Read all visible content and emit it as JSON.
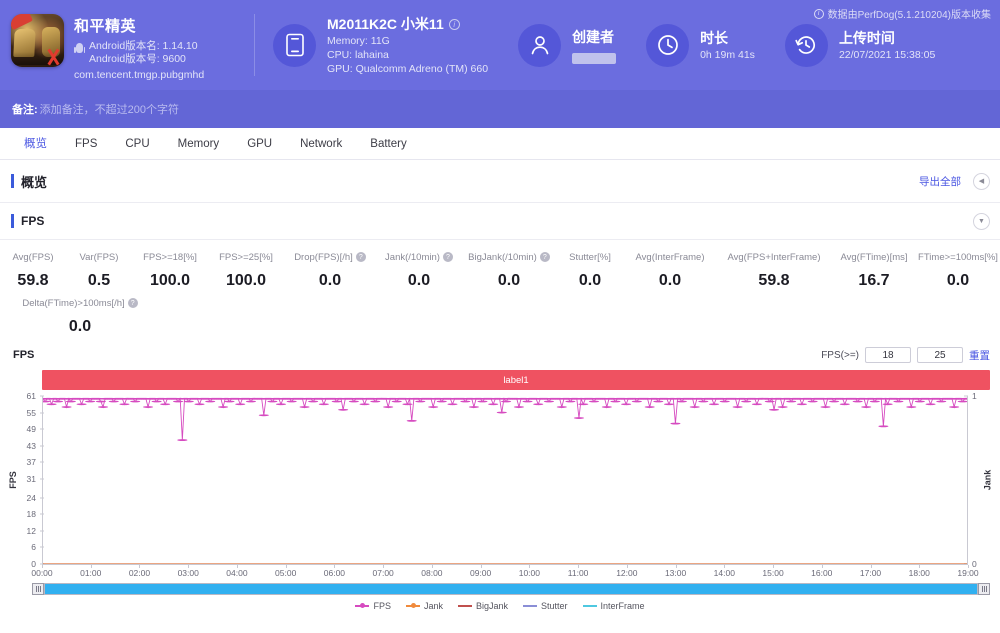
{
  "header": {
    "app": {
      "name": "和平精英",
      "version_name_label": "Android版本名: 1.14.10",
      "version_code_label": "Android版本号: 9600",
      "package": "com.tencent.tmgp.pubgmhd",
      "icon": "game-app-icon"
    },
    "device": {
      "title": "M2011K2C 小米11",
      "info_icon": "info-icon",
      "memory": "Memory: 11G",
      "cpu": "CPU: lahaina",
      "gpu": "GPU: Qualcomm Adreno (TM) 660",
      "icon": "phone-icon"
    },
    "creator": {
      "title": "创建者",
      "value": "",
      "icon": "user-icon"
    },
    "duration": {
      "title": "时长",
      "value": "0h 19m 41s",
      "icon": "clock-icon"
    },
    "upload_time": {
      "title": "上传时间",
      "value": "22/07/2021 15:38:05",
      "icon": "history-icon"
    },
    "perfdog_note": "数据由PerfDog(5.1.210204)版本收集",
    "remark_label": "备注:",
    "remark_placeholder": "添加备注，不超过200个字符"
  },
  "tabs": [
    {
      "label": "概览",
      "active": true
    },
    {
      "label": "FPS",
      "active": false
    },
    {
      "label": "CPU",
      "active": false
    },
    {
      "label": "Memory",
      "active": false
    },
    {
      "label": "GPU",
      "active": false
    },
    {
      "label": "Network",
      "active": false
    },
    {
      "label": "Battery",
      "active": false
    }
  ],
  "overview": {
    "title": "概览",
    "export_all": "导出全部",
    "collapse_icon": "chevron-left-icon"
  },
  "fps_section": {
    "title": "FPS",
    "collapse_icon": "chevron-down-icon",
    "metrics_row1": [
      {
        "label": "Avg(FPS)",
        "value": "59.8",
        "help": false
      },
      {
        "label": "Var(FPS)",
        "value": "0.5",
        "help": false
      },
      {
        "label": "FPS>=18[%]",
        "value": "100.0",
        "help": false
      },
      {
        "label": "FPS>=25[%]",
        "value": "100.0",
        "help": false
      },
      {
        "label": "Drop(FPS)[/h]",
        "value": "0.0",
        "help": true
      },
      {
        "label": "Jank(/10min)",
        "value": "0.0",
        "help": true
      },
      {
        "label": "BigJank(/10min)",
        "value": "0.0",
        "help": true
      },
      {
        "label": "Stutter[%]",
        "value": "0.0",
        "help": false
      },
      {
        "label": "Avg(InterFrame)",
        "value": "0.0",
        "help": false
      },
      {
        "label": "Avg(FPS+InterFrame)",
        "value": "59.8",
        "help": false
      },
      {
        "label": "Avg(FTime)[ms]",
        "value": "16.7",
        "help": false
      },
      {
        "label": "FTime>=100ms[%]",
        "value": "0.0",
        "help": false
      }
    ],
    "metrics_row2": [
      {
        "label": "Delta(FTime)>100ms[/h]",
        "value": "0.0",
        "help": true
      }
    ]
  },
  "chart_controls": {
    "chart_label": "FPS",
    "fps_gte_label": "FPS(>=)",
    "threshold_low": "18",
    "threshold_high": "25",
    "reset_label": "重置",
    "banner_label": "label1"
  },
  "chart_data": {
    "type": "line",
    "title": "FPS",
    "xlabel": "",
    "ylabel": "FPS",
    "y2label": "Jank",
    "ylim": [
      0,
      61
    ],
    "y2lim": [
      0,
      1
    ],
    "yticks": [
      0,
      6,
      12,
      18,
      24,
      31,
      37,
      43,
      49,
      55,
      61
    ],
    "y2ticks": [
      0,
      1
    ],
    "xticks": [
      "00:00",
      "01:00",
      "02:00",
      "03:00",
      "04:00",
      "05:00",
      "06:00",
      "07:00",
      "08:00",
      "09:00",
      "10:00",
      "11:00",
      "12:00",
      "13:00",
      "14:00",
      "15:00",
      "16:00",
      "17:00",
      "18:00",
      "19:00"
    ],
    "grid": false,
    "legend_position": "bottom",
    "series": [
      {
        "name": "FPS",
        "color": "#d64bc0",
        "axis": "left",
        "avg": 59.8,
        "min": 45,
        "max": 61,
        "note": "Dense near-flat trace at ~59-60 fps with sporadic downward spikes"
      },
      {
        "name": "Jank",
        "color": "#f08a3c",
        "axis": "right",
        "values_all_zero": true
      },
      {
        "name": "BigJank",
        "color": "#c0504d",
        "axis": "right",
        "values_all_zero": true
      },
      {
        "name": "Stutter",
        "color": "#8a8ed6",
        "axis": "right",
        "values_all_zero": true
      },
      {
        "name": "InterFrame",
        "color": "#4ec8e0",
        "axis": "right",
        "values_all_zero": true
      }
    ],
    "fps_points": [
      60,
      59,
      60,
      60,
      58,
      60,
      60,
      59,
      60,
      60,
      60,
      57,
      60,
      59,
      60,
      60,
      60,
      60,
      58,
      60,
      60,
      60,
      59,
      60,
      60,
      60,
      60,
      59,
      57,
      60,
      60,
      60,
      60,
      59,
      60,
      60,
      60,
      60,
      58,
      60,
      60,
      60,
      60,
      59,
      60,
      60,
      60,
      60,
      60,
      57,
      60,
      60,
      60,
      59,
      60,
      60,
      60,
      58,
      60,
      60,
      60,
      60,
      60,
      59,
      60,
      45,
      60,
      60,
      59,
      60,
      60,
      60,
      60,
      58,
      60,
      60,
      60,
      60,
      59,
      60,
      60,
      60,
      60,
      60,
      57,
      60,
      60,
      59,
      60,
      60,
      60,
      60,
      58,
      60,
      60,
      60,
      60,
      59,
      60,
      60,
      60,
      60,
      60,
      54,
      60,
      60,
      60,
      59,
      60,
      60,
      60,
      58,
      60,
      60,
      60,
      60,
      59,
      60,
      60,
      60,
      60,
      60,
      57,
      60,
      60,
      60,
      59,
      60,
      60,
      60,
      60,
      58,
      60,
      60,
      60,
      60,
      60,
      59,
      60,
      60,
      56,
      60,
      60,
      60,
      60,
      59,
      60,
      60,
      60,
      60,
      58,
      60,
      60,
      60,
      60,
      59,
      60,
      60,
      60,
      60,
      60,
      57,
      60,
      60,
      60,
      59,
      60,
      60,
      60,
      60,
      58,
      60,
      52,
      60,
      60,
      60,
      59,
      60,
      60,
      60,
      60,
      60,
      57,
      60,
      60,
      60,
      59,
      60,
      60,
      60,
      60,
      58,
      60,
      60,
      60,
      60,
      60,
      59,
      60,
      60,
      60,
      57,
      60,
      60,
      60,
      59,
      60,
      60,
      60,
      60,
      58,
      60,
      60,
      60,
      55,
      60,
      59,
      60,
      60,
      60,
      60,
      60,
      57,
      60,
      60,
      60,
      59,
      60,
      60,
      60,
      60,
      58,
      60,
      60,
      60,
      60,
      59,
      60,
      60,
      60,
      60,
      60,
      57,
      60,
      60,
      60,
      59,
      60,
      60,
      60,
      53,
      60,
      58,
      60,
      60,
      60,
      60,
      59,
      60,
      60,
      60,
      60,
      60,
      57,
      60,
      60,
      60,
      59,
      60,
      60,
      60,
      60,
      58,
      60,
      60,
      60,
      60,
      59,
      60,
      60,
      60,
      60,
      60,
      57,
      60,
      60,
      60,
      59,
      60,
      60,
      60,
      60,
      58,
      60,
      60,
      51,
      60,
      60,
      59,
      60,
      60,
      60,
      60,
      60,
      57,
      60,
      60,
      60,
      59,
      60,
      60,
      60,
      60,
      58,
      60,
      60,
      60,
      60,
      59,
      60,
      60,
      60,
      60,
      60,
      57,
      60,
      60,
      60,
      59,
      60,
      60,
      60,
      60,
      58,
      60,
      60,
      60,
      60,
      60,
      59,
      60,
      56,
      60,
      60,
      60,
      57,
      60,
      60,
      60,
      59,
      60,
      60,
      60,
      60,
      58,
      60,
      60,
      60,
      60,
      59,
      60,
      60,
      60,
      60,
      60,
      57,
      60,
      60,
      60,
      59,
      60,
      60,
      60,
      60,
      58,
      60,
      60,
      60,
      60,
      60,
      59,
      60,
      60,
      60,
      57,
      60,
      60,
      60,
      59,
      60,
      60,
      60,
      50,
      60,
      58,
      60,
      60,
      60,
      60,
      59,
      60,
      60,
      60,
      60,
      60,
      57,
      60,
      60,
      60,
      59,
      60,
      60,
      60,
      60,
      58,
      60,
      60,
      60,
      60,
      59,
      60,
      60,
      60,
      60,
      60,
      57,
      60,
      60,
      60,
      59,
      60,
      60
    ]
  },
  "legend": [
    {
      "label": "FPS",
      "color": "#d64bc0",
      "marker": "line-dot"
    },
    {
      "label": "Jank",
      "color": "#f08a3c",
      "marker": "line-dot"
    },
    {
      "label": "BigJank",
      "color": "#c0504d",
      "marker": "line"
    },
    {
      "label": "Stutter",
      "color": "#8a8ed6",
      "marker": "line"
    },
    {
      "label": "InterFrame",
      "color": "#4ec8e0",
      "marker": "line"
    }
  ],
  "range_slider": {
    "left_handle": "range-handle-left",
    "right_handle": "range-handle-right",
    "fill_percent": 100
  },
  "colors": {
    "header_bg": "#6b6ddf",
    "accent": "#4a56e2",
    "banner": "#ef5261",
    "fps_line": "#d64bc0",
    "slider": "#31b0f0"
  }
}
